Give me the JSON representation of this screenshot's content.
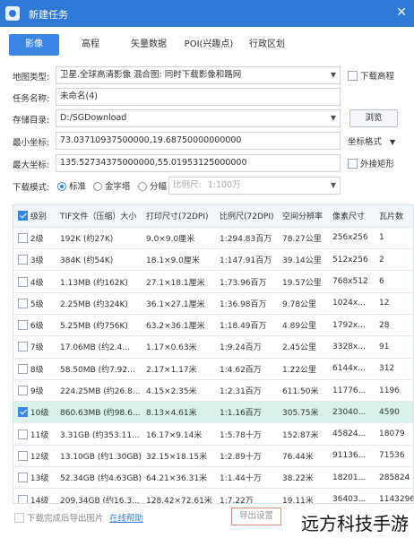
{
  "window": {
    "title": "新建任务",
    "close_icon": "close-icon"
  },
  "tabs": [
    {
      "label": "影像",
      "active": true
    },
    {
      "label": "高程",
      "active": false
    },
    {
      "label": "矢量数据",
      "active": false
    },
    {
      "label": "POI(兴趣点)",
      "active": false
    },
    {
      "label": "行政区划",
      "active": false
    }
  ],
  "form": {
    "map_type_label": "地图类型:",
    "map_type_value": "卫星.全球高清影像  混合图: 同时下载影像和路网",
    "download_elevation_label": "下载高程",
    "task_name_label": "任务名称:",
    "task_name_value": "未命名(4)",
    "save_dir_label": "存储目录:",
    "save_dir_value": "D:/SGDownload",
    "browse_label": "浏览",
    "min_coord_label": "最小坐标:",
    "min_coord_value": "73.03710937500000,19.68750000000000",
    "coord_format_label": "坐标格式",
    "max_coord_label": "最大坐标:",
    "max_coord_value": "135.52734375000000,55.01953125000000",
    "outer_rect_label": "外接矩形",
    "download_mode_label": "下载模式:",
    "mode_standard": "标准",
    "mode_pyramid": "金字塔",
    "mode_tile": "分幅",
    "scale_label": "比例尺:",
    "scale_value": "1:100万"
  },
  "table": {
    "headers": [
      "级别",
      "TIF文件（压缩）大小",
      "打印尺寸(72DPI)",
      "比例尺(72DPI)",
      "空间分辨率",
      "像素尺寸",
      "瓦片数"
    ],
    "rows": [
      {
        "checked": false,
        "level": "2级",
        "size": "192K (约27K)",
        "print": "9.0×9.0厘米",
        "scale": "1:294.83百万",
        "res": "78.27公里",
        "pixels": "256x256",
        "tiles": "1"
      },
      {
        "checked": false,
        "level": "3级",
        "size": "384K (约54K)",
        "print": "18.1×9.0厘米",
        "scale": "1:147.91百万",
        "res": "39.14公里",
        "pixels": "512x256",
        "tiles": "2"
      },
      {
        "checked": false,
        "level": "4级",
        "size": "1.13MB (约162K)",
        "print": "27.1×18.1厘米",
        "scale": "1:73.96百万",
        "res": "19.57公里",
        "pixels": "768x512",
        "tiles": "6"
      },
      {
        "checked": false,
        "level": "5级",
        "size": "2.25MB (约324K)",
        "print": "36.1×27.1厘米",
        "scale": "1:36.98百万",
        "res": "9.78公里",
        "pixels": "1024x...",
        "tiles": "12"
      },
      {
        "checked": false,
        "level": "6级",
        "size": "5.25MB (约756K)",
        "print": "63.2×36.1厘米",
        "scale": "1:18.49百万",
        "res": "4.89公里",
        "pixels": "1792x...",
        "tiles": "28"
      },
      {
        "checked": false,
        "level": "7级",
        "size": "17.06MB (约2.4...",
        "print": "1.17×0.63米",
        "scale": "1:9.24百万",
        "res": "2.45公里",
        "pixels": "3328x...",
        "tiles": "91"
      },
      {
        "checked": false,
        "level": "8级",
        "size": "58.50MB (约7.92...",
        "print": "2.17×1.17米",
        "scale": "1:4.62百万",
        "res": "1.22公里",
        "pixels": "6144x...",
        "tiles": "312"
      },
      {
        "checked": false,
        "level": "9级",
        "size": "224.25MB (约26.8...",
        "print": "4.15×2.35米",
        "scale": "1:2.31百万",
        "res": "611.50米",
        "pixels": "11776...",
        "tiles": "1196"
      },
      {
        "checked": true,
        "level": "10级",
        "size": "860.63MB (约98.6...",
        "print": "8.13×4.61米",
        "scale": "1:1.16百万",
        "res": "305.75米",
        "pixels": "23040...",
        "tiles": "4590"
      },
      {
        "checked": false,
        "level": "11级",
        "size": "3.31GB (约353.11...",
        "print": "16.17×9.14米",
        "scale": "1:5.78十万",
        "res": "152.87米",
        "pixels": "45824...",
        "tiles": "18079"
      },
      {
        "checked": false,
        "level": "12级",
        "size": "13.10GB (约1.30GB)",
        "print": "32.15×18.15米",
        "scale": "1:2.89十万",
        "res": "76.44米",
        "pixels": "91136...",
        "tiles": "71536"
      },
      {
        "checked": false,
        "level": "13级",
        "size": "52.34GB (约4.63GB)",
        "print": "64.21×36.31米",
        "scale": "1:1.44十万",
        "res": "38.22米",
        "pixels": "18201...",
        "tiles": "285824"
      },
      {
        "checked": false,
        "level": "14级",
        "size": "209.34GB (约16.3...",
        "print": "128.42×72.61米",
        "scale": "1:7.22万",
        "res": "19.11米",
        "pixels": "36403...",
        "tiles": "1143296"
      }
    ]
  },
  "footer": {
    "export_after_label": "下载完成后导出图片",
    "online_help_label": "在线帮助",
    "export_settings_label": "导出设置"
  },
  "watermark": "远方科技手游",
  "colors": {
    "titlebar": "#2f7ad6",
    "accent": "#3a86e4",
    "selected_row": "#d9f2ec"
  }
}
